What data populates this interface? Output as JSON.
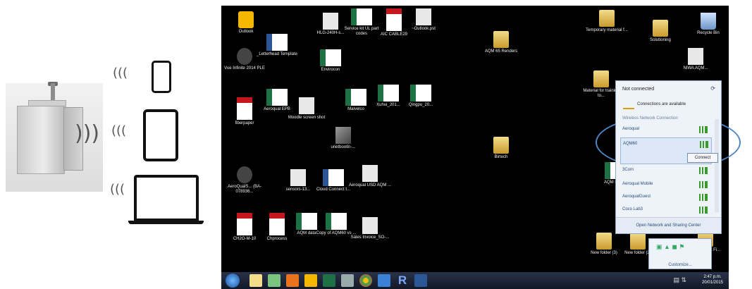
{
  "desktop_icons": [
    {
      "label": "Outlook",
      "glyph": "outlook-icon"
    },
    {
      "label": "_Letterhead Template",
      "glyph": "word-icon"
    },
    {
      "label": "HLG-240H-s...",
      "glyph": "document-icon"
    },
    {
      "label": "Service kit UL part codes",
      "glyph": "excel-icon"
    },
    {
      "label": "AIC CABLE29",
      "glyph": "pdf-icon"
    },
    {
      "label": "~Outlook.pst",
      "glyph": "file-icon"
    },
    {
      "label": "Vue Infinite 2014 PLE",
      "glyph": "app-icon"
    },
    {
      "label": "Envirocon",
      "glyph": "excel-icon"
    },
    {
      "label": "AQM 65 Renders",
      "glyph": "folder-icon"
    },
    {
      "label": "Temporary material f...",
      "glyph": "folder-icon"
    },
    {
      "label": "Solutioning",
      "glyph": "folder-icon"
    },
    {
      "label": "Recycle Bin",
      "glyph": "recycle-bin-icon"
    },
    {
      "label": "NIWA AQM...",
      "glyph": "document-icon"
    },
    {
      "label": "fiberpaper",
      "glyph": "pdf-icon"
    },
    {
      "label": "Aeroqual EPB",
      "glyph": "excel-icon"
    },
    {
      "label": "Moodle screen shot",
      "glyph": "document-icon"
    },
    {
      "label": "Malvelco",
      "glyph": "excel-icon"
    },
    {
      "label": "Xuhui_201...",
      "glyph": "excel-icon"
    },
    {
      "label": "Qingpu_20...",
      "glyph": "excel-icon"
    },
    {
      "label": "Material for training to...",
      "glyph": "folder-icon"
    },
    {
      "label": "unetbootin-...",
      "glyph": "tool-icon"
    },
    {
      "label": "Birtech",
      "glyph": "folder-icon"
    },
    {
      "label": "AeroQualS... (BA-078936...",
      "glyph": "app-icon"
    },
    {
      "label": "sensors-13...",
      "glyph": "document-icon"
    },
    {
      "label": "Cloud Connect t...",
      "glyph": "word-icon"
    },
    {
      "label": "Aeroqual USD AQM ...",
      "glyph": "document-icon"
    },
    {
      "label": "AQM HIVI...",
      "glyph": "excel-icon"
    },
    {
      "label": "CH2O-M-10",
      "glyph": "pdf-icon"
    },
    {
      "label": "Chprocess",
      "glyph": "pdf-icon"
    },
    {
      "label": "AQM data",
      "glyph": "excel-icon"
    },
    {
      "label": "Copy of AQM60 vs ...",
      "glyph": "excel-icon"
    },
    {
      "label": "Sales Invoice_SO-...",
      "glyph": "document-icon"
    },
    {
      "label": "New folder (3)",
      "glyph": "folder-icon"
    },
    {
      "label": "New folder (2)",
      "glyph": "folder-icon"
    },
    {
      "label": "...dy of ...ist Fi...",
      "glyph": "folder-icon"
    }
  ],
  "network_popup": {
    "status": "Not connected",
    "available": "Connections are available",
    "section": "Wireless Network Connection",
    "connect_label": "Connect",
    "footer": "Open Network and Sharing Center",
    "networks": [
      {
        "name": "Aeroqual",
        "selected": false
      },
      {
        "name": "AQM60",
        "selected": true
      },
      {
        "name": "3Com",
        "selected": false
      },
      {
        "name": "Aeroqual Mobile",
        "selected": false
      },
      {
        "name": "AeroqualGuest",
        "selected": false
      },
      {
        "name": "Coco Lab3",
        "selected": false
      }
    ]
  },
  "tray_popup": {
    "customize": "Customize..."
  },
  "clock": {
    "time": "2:47 p.m.",
    "date": "20/01/2015"
  },
  "colors": {
    "highlight_ellipse": "#4f86c7",
    "desktop": "#000000"
  }
}
